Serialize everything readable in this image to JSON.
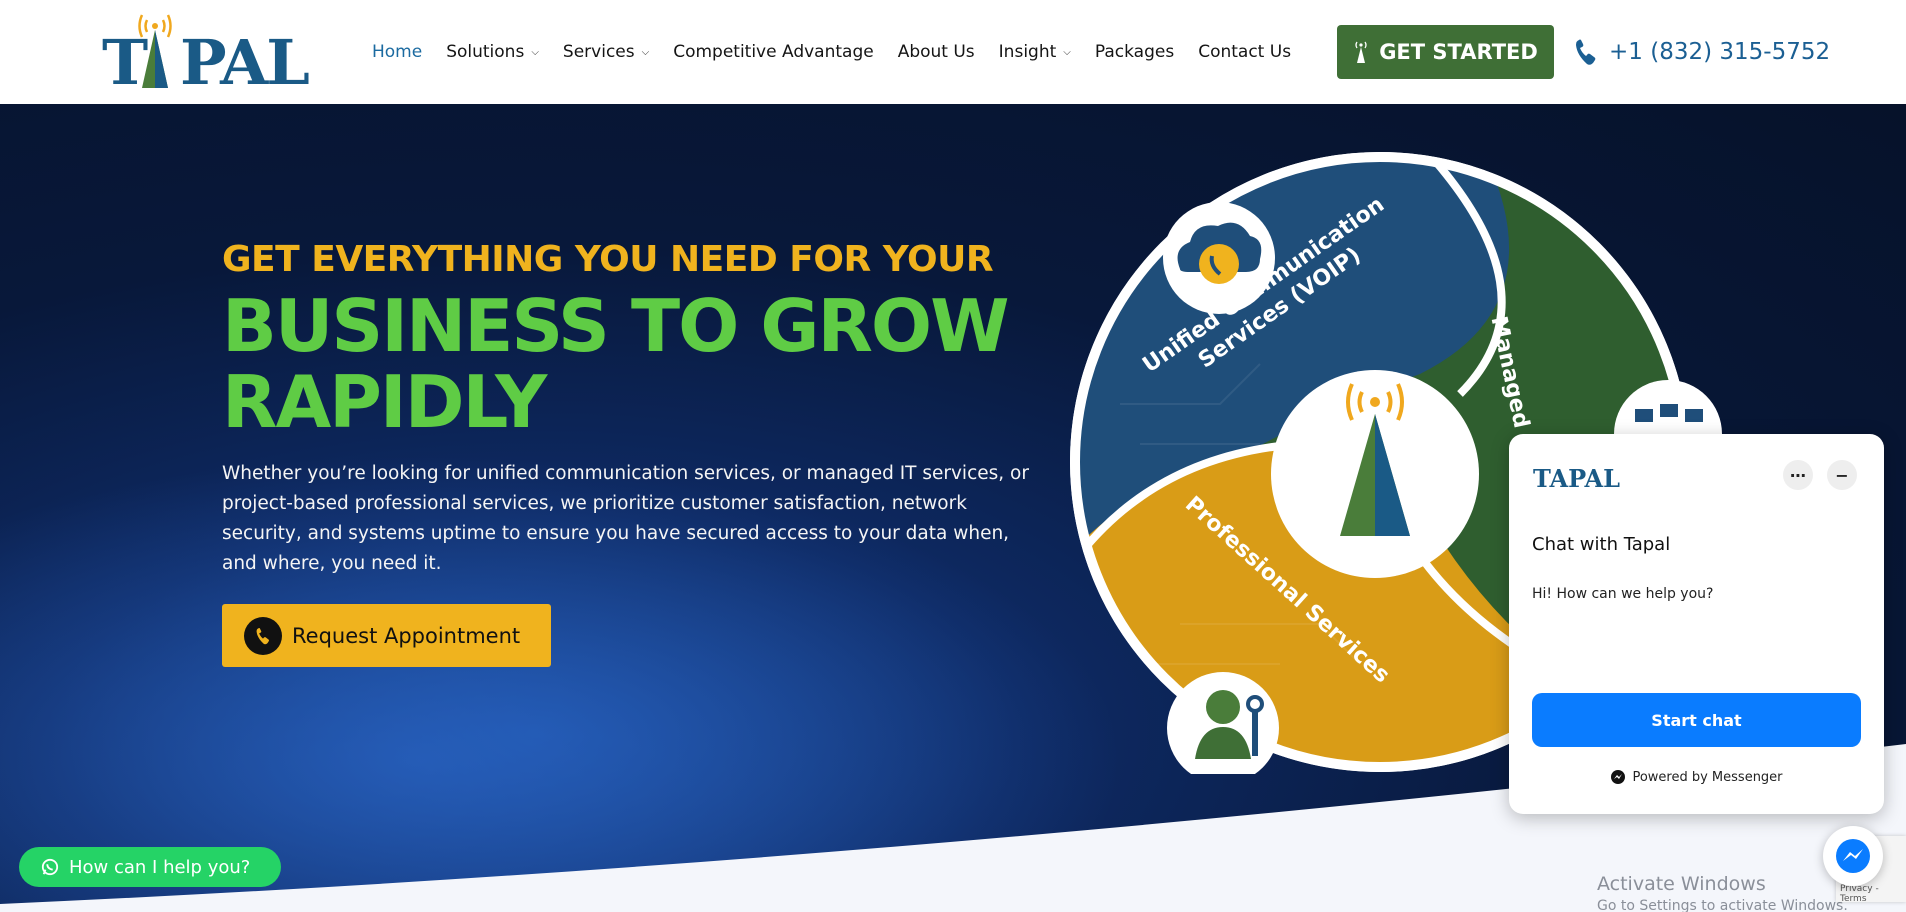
{
  "header": {
    "logo_text": "TAPAL",
    "nav": [
      {
        "label": "Home",
        "active": true,
        "dropdown": false
      },
      {
        "label": "Solutions",
        "active": false,
        "dropdown": true
      },
      {
        "label": "Services",
        "active": false,
        "dropdown": true
      },
      {
        "label": "Competitive Advantage",
        "active": false,
        "dropdown": false
      },
      {
        "label": "About Us",
        "active": false,
        "dropdown": false
      },
      {
        "label": "Insight",
        "active": false,
        "dropdown": true
      },
      {
        "label": "Packages",
        "active": false,
        "dropdown": false
      },
      {
        "label": "Contact Us",
        "active": false,
        "dropdown": false
      }
    ],
    "cta_label": "GET STARTED",
    "phone": "+1 (832) 315-5752"
  },
  "hero": {
    "subheading": "GET EVERYTHING YOU NEED FOR YOUR",
    "heading_line1": "BUSINESS TO GROW",
    "heading_line2": "RAPIDLY",
    "body": "Whether you’re looking for unified communication services, or managed IT services, or project-based professional services, we prioritize customer satisfaction, network security, and systems uptime to ensure you have secured access to your data when, and where, you need it.",
    "appointment_label": "Request Appointment",
    "segments": {
      "ucs_line1": "Unified Communication",
      "ucs_line2": "Services (VOIP)",
      "managed": "Managed IT",
      "professional": "Professional Services"
    }
  },
  "whatsapp": {
    "label": "How can I help you?"
  },
  "chat": {
    "logo_text": "TAPAL",
    "title": "Chat with Tapal",
    "message": "Hi! How can we help you?",
    "start_label": "Start chat",
    "powered": "Powered by Messenger"
  },
  "windows": {
    "activate": "Activate Windows",
    "activate_sub": "Go to Settings to activate Windows."
  },
  "recaptcha": {
    "text": "Privacy - Terms"
  },
  "colors": {
    "brand_blue": "#1a5a86",
    "green": "#3f6f36",
    "yellow": "#f0b31e",
    "hero_green": "#5fcc45",
    "messenger_blue": "#0a7cff"
  }
}
